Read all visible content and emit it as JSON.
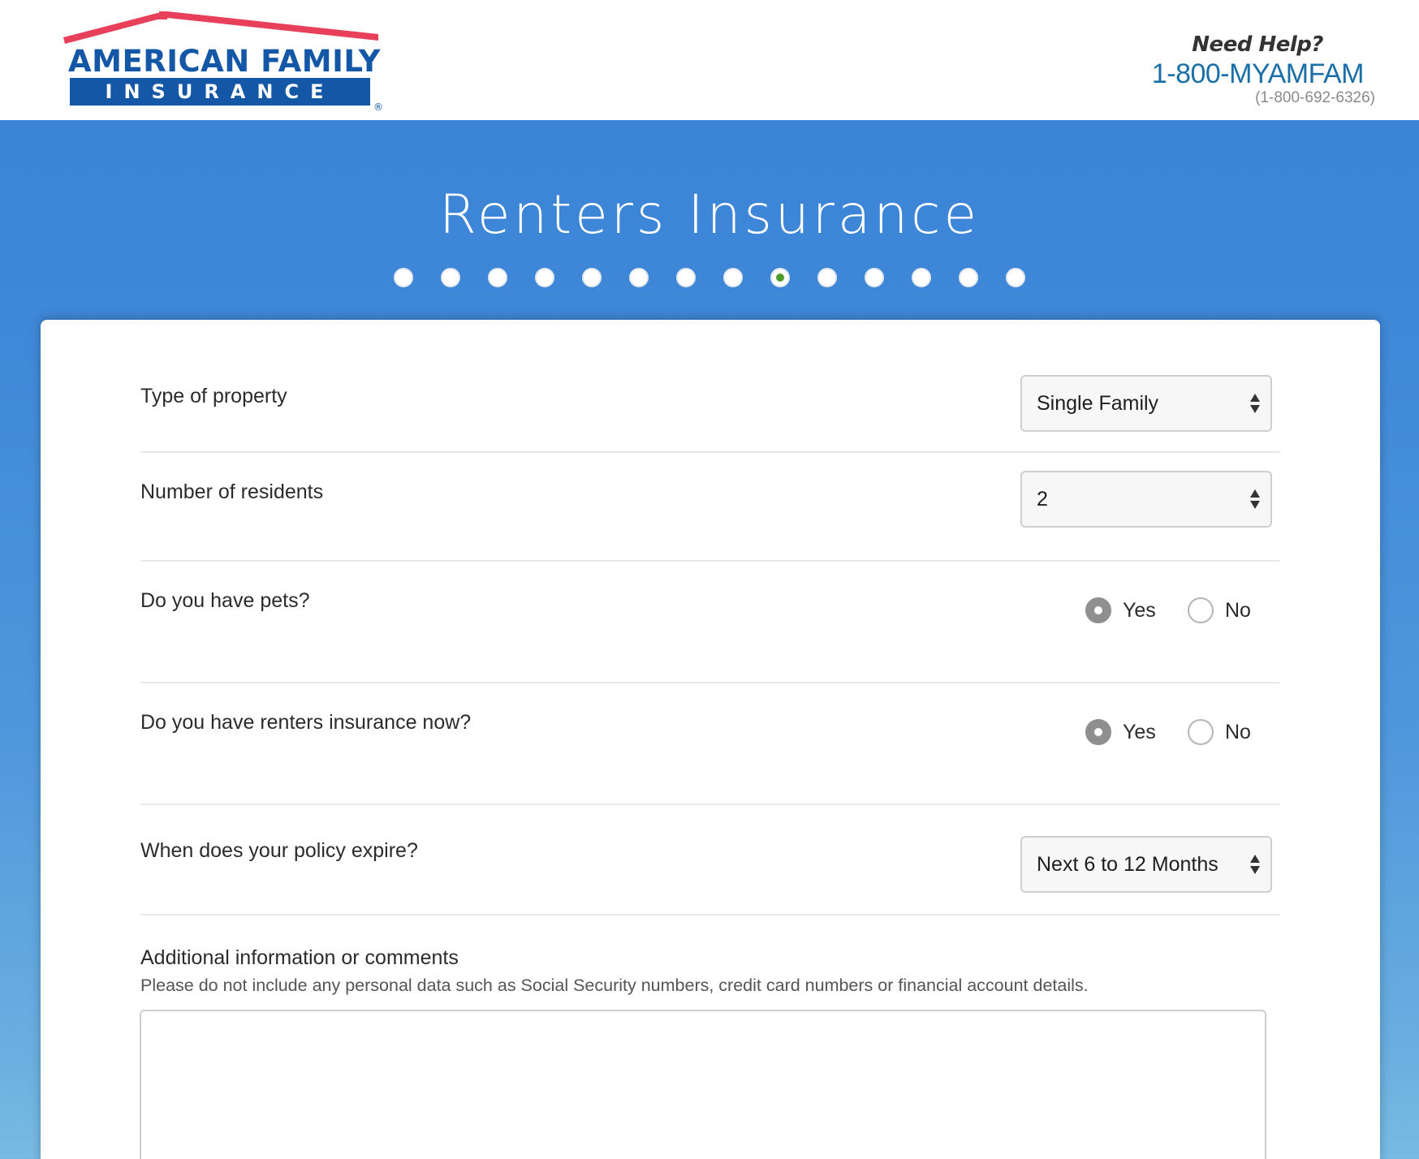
{
  "brand": {
    "name_line1": "AMERICAN FAMILY",
    "name_line2": "INSURANCE",
    "registered": "®",
    "colors": {
      "roof": "#e8405a",
      "blue": "#1357a6"
    }
  },
  "help": {
    "title": "Need Help?",
    "phone": "1-800-MYAMFAM",
    "digits": "(1-800-692-6326)"
  },
  "page": {
    "title": "Renters Insurance",
    "progress": {
      "total_steps": 14,
      "current_step": 9
    }
  },
  "form": {
    "property_type": {
      "label": "Type of property",
      "value": "Single Family"
    },
    "residents": {
      "label": "Number of residents",
      "value": "2"
    },
    "pets": {
      "label": "Do you have pets?",
      "yes": "Yes",
      "no": "No",
      "selected": "Yes"
    },
    "current_insurance": {
      "label": "Do you have renters insurance now?",
      "yes": "Yes",
      "no": "No",
      "selected": "Yes"
    },
    "policy_expire": {
      "label": "When does your policy expire?",
      "value": "Next 6 to 12 Months"
    },
    "comments": {
      "label": "Additional information or comments",
      "note": "Please do not include any personal data such as Social Security numbers, credit card numbers or financial account details.",
      "value": ""
    }
  },
  "icons": {
    "select_arrows": "up-down-chevron-icon",
    "progress_dot": "step-dot-icon"
  }
}
